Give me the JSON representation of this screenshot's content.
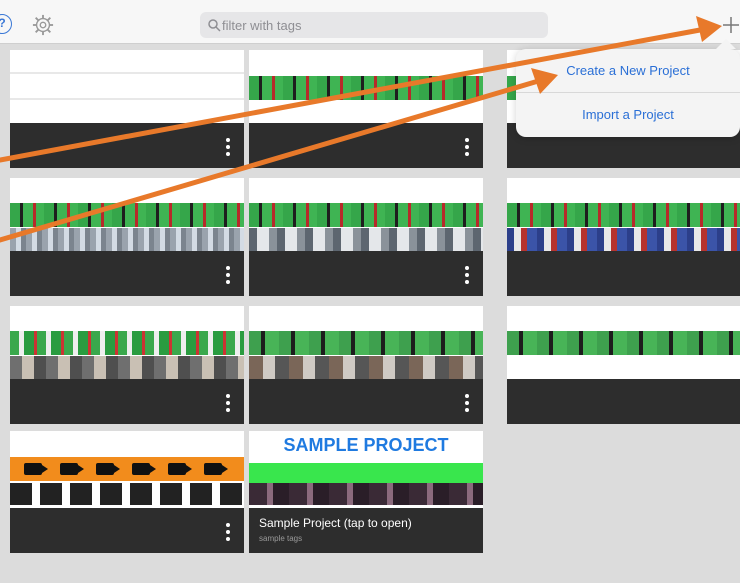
{
  "header": {
    "search_placeholder": "filter with tags",
    "help_icon": "help-icon",
    "settings_icon": "gear-icon",
    "add_icon": "plus-icon"
  },
  "popover_menu": {
    "items": [
      {
        "label": "Create a New Project"
      },
      {
        "label": "Import a Project"
      }
    ]
  },
  "projects": {
    "sample": {
      "banner": "SAMPLE PROJECT",
      "name": "Sample Project (tap to open)",
      "tags": "sample tags"
    }
  },
  "colors": {
    "accent": "#2a6fd6",
    "annotation_arrow": "#e8792a",
    "tile_footer": "#2d2d2d",
    "background": "#dcdcdc"
  }
}
